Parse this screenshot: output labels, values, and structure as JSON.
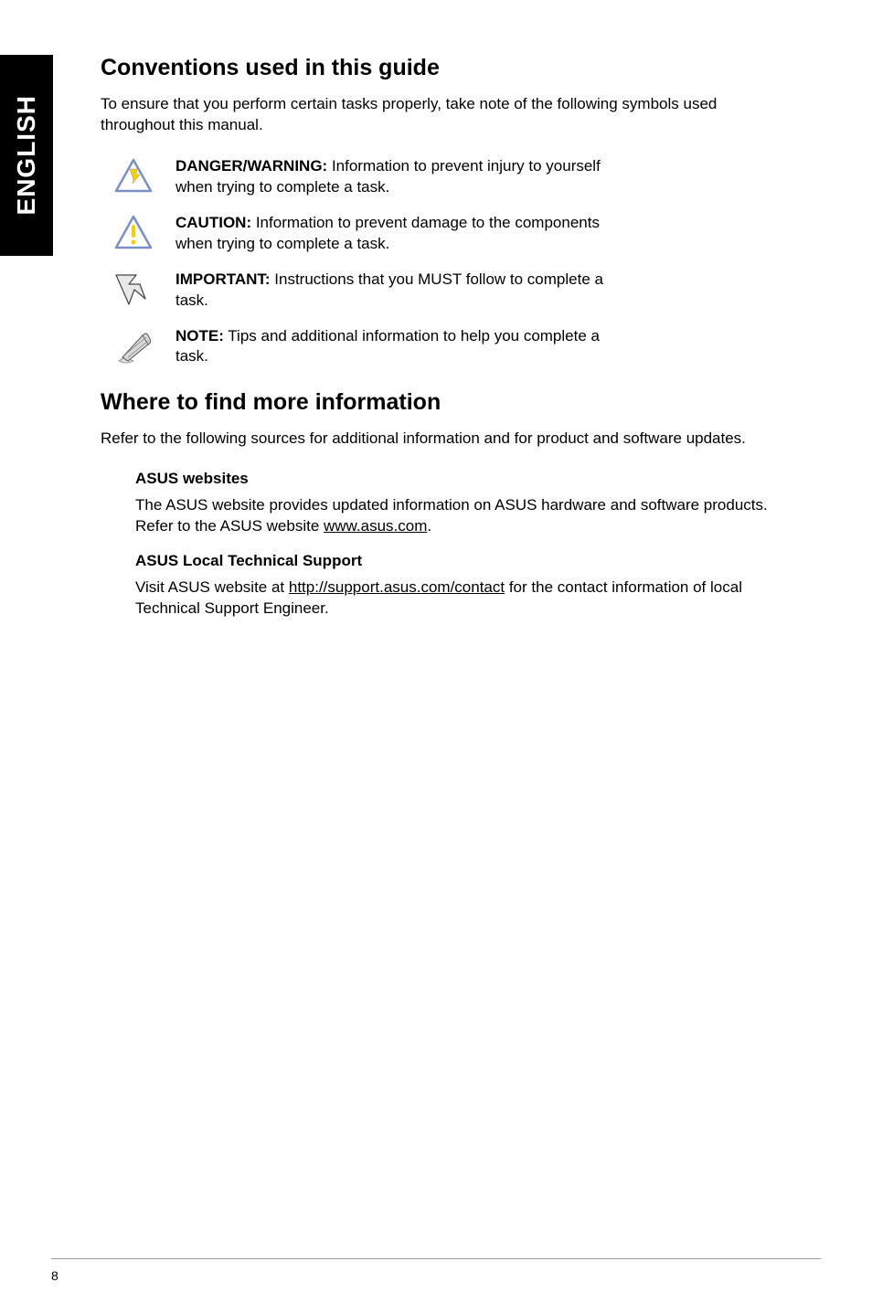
{
  "sidebar": {
    "language": "ENGLISH"
  },
  "section1": {
    "heading": "Conventions used in this guide",
    "intro": "To ensure that you perform certain tasks properly, take note of the following symbols used throughout this manual.",
    "items": [
      {
        "bold": "DANGER/WARNING:",
        "text": "  Information to prevent injury to yourself when trying to complete a task."
      },
      {
        "bold": "CAUTION:",
        "text": " Information to prevent damage to the components when trying to complete a task."
      },
      {
        "bold": "IMPORTANT:",
        "text": " Instructions that you MUST follow to complete a task."
      },
      {
        "bold": "NOTE:",
        "text": " Tips and additional information to help you complete a task."
      }
    ]
  },
  "section2": {
    "heading": "Where to find more information",
    "intro": "Refer to the following sources for additional information and for product and software updates.",
    "sub1": {
      "heading": "ASUS websites",
      "text_pre": "The ASUS website provides updated information on ASUS hardware and software products. Refer to the ASUS website ",
      "link": "www.asus.com",
      "text_post": "."
    },
    "sub2": {
      "heading": "ASUS Local Technical Support",
      "text_pre": "Visit ASUS website at ",
      "link": "http://support.asus.com/contact",
      "text_post": " for the contact information of local Technical Support Engineer."
    }
  },
  "page_number": "8"
}
